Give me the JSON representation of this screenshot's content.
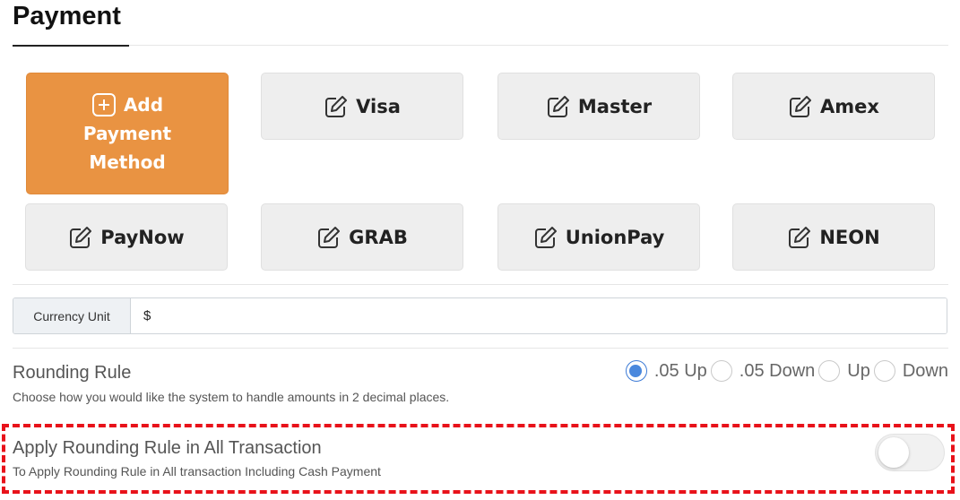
{
  "page_title": "Payment",
  "add_button": {
    "line1": "Add",
    "line2": "Payment",
    "line3": "Method",
    "icon": "plus-square-icon",
    "color": "#e99342"
  },
  "methods": [
    {
      "label": "Visa",
      "icon": "edit-icon"
    },
    {
      "label": "Master",
      "icon": "edit-icon"
    },
    {
      "label": "Amex",
      "icon": "edit-icon"
    },
    {
      "label": "PayNow",
      "icon": "edit-icon"
    },
    {
      "label": "GRAB",
      "icon": "edit-icon"
    },
    {
      "label": "UnionPay",
      "icon": "edit-icon"
    },
    {
      "label": "NEON",
      "icon": "edit-icon"
    }
  ],
  "currency": {
    "label": "Currency Unit",
    "value": "$"
  },
  "rounding": {
    "title": "Rounding Rule",
    "description": "Choose how you would like the system to handle amounts in 2 decimal places.",
    "options": [
      ".05 Up",
      ".05 Down",
      "Up",
      "Down"
    ],
    "selected": ".05 Up",
    "selected_color": "#4a88dd"
  },
  "apply_all": {
    "title": "Apply Rounding Rule in All Transaction",
    "description": "To Apply Rounding Rule in All transaction Including Cash Payment",
    "enabled": false,
    "highlight_color": "#e8121a"
  }
}
